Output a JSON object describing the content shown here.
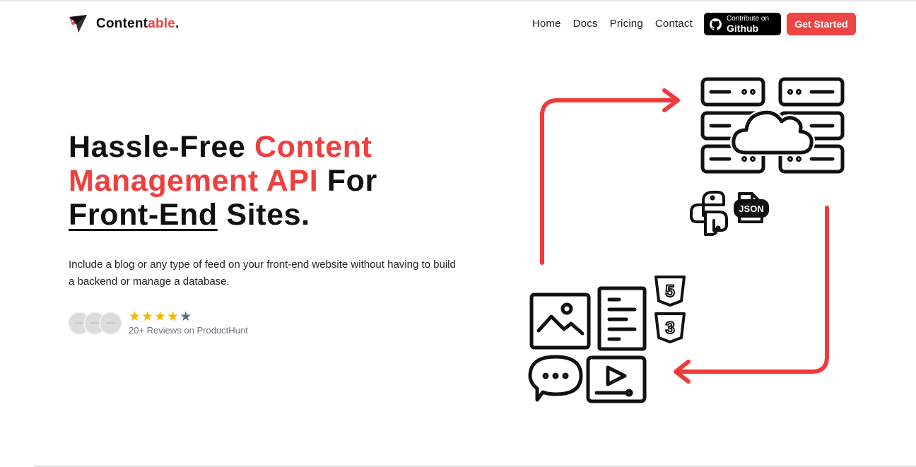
{
  "brand": {
    "name_main": "Content",
    "name_accent": "able",
    "name_dot": "."
  },
  "nav": {
    "links": [
      "Home",
      "Docs",
      "Pricing",
      "Contact"
    ],
    "github_small": "Contribute on",
    "github_big": "Github",
    "cta": "Get Started"
  },
  "hero": {
    "title_part1": "Hassle-Free ",
    "title_part2": "Content Management API",
    "title_part3": " For",
    "title_part4": "Front-End",
    "title_part5": " Sites.",
    "subtitle": "Include a blog or any type of feed on your front-end website without having to build a backend or manage a database.",
    "reviews_text": "20+ Reviews on ProductHunt",
    "rating": 4,
    "rating_max": 5
  },
  "illustration": {
    "json_label": "JSON",
    "html_label": "5",
    "css_label": "3"
  },
  "colors": {
    "accent": "#ef4444",
    "star": "#f4b400",
    "star_off": "#5b6a86"
  }
}
